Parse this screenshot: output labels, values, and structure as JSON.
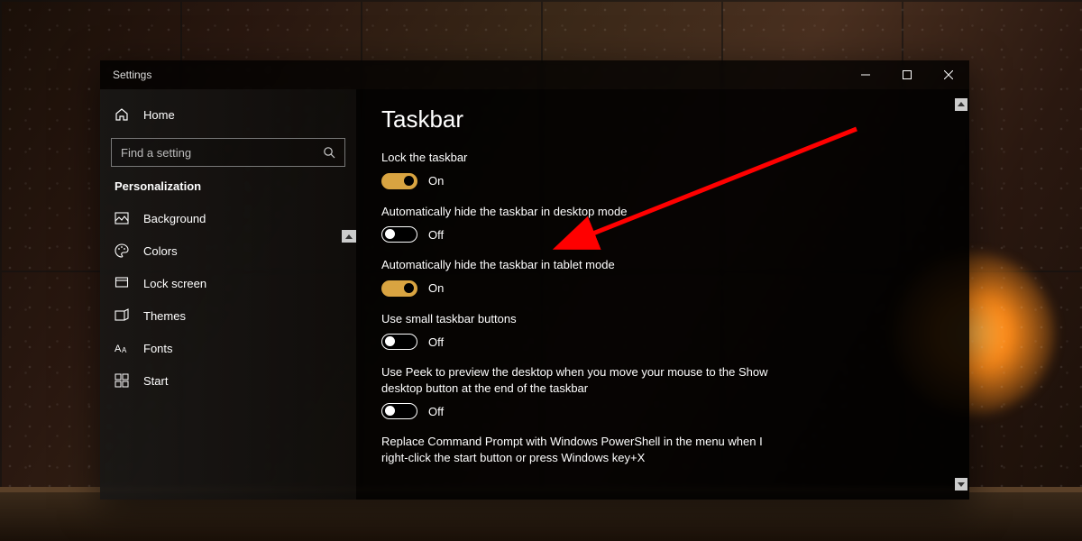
{
  "window": {
    "title": "Settings"
  },
  "sidebar": {
    "home": "Home",
    "search_placeholder": "Find a setting",
    "section": "Personalization",
    "items": [
      {
        "key": "background",
        "label": "Background"
      },
      {
        "key": "colors",
        "label": "Colors"
      },
      {
        "key": "lockscreen",
        "label": "Lock screen"
      },
      {
        "key": "themes",
        "label": "Themes"
      },
      {
        "key": "fonts",
        "label": "Fonts"
      },
      {
        "key": "start",
        "label": "Start"
      }
    ]
  },
  "content": {
    "heading": "Taskbar",
    "settings": [
      {
        "key": "lock",
        "label": "Lock the taskbar",
        "value": true,
        "state_label": "On"
      },
      {
        "key": "autohide_desktop",
        "label": "Automatically hide the taskbar in desktop mode",
        "value": false,
        "state_label": "Off"
      },
      {
        "key": "autohide_tablet",
        "label": "Automatically hide the taskbar in tablet mode",
        "value": true,
        "state_label": "On"
      },
      {
        "key": "small_buttons",
        "label": "Use small taskbar buttons",
        "value": false,
        "state_label": "Off"
      },
      {
        "key": "peek",
        "label": "Use Peek to preview the desktop when you move your mouse to the Show desktop button at the end of the taskbar",
        "value": false,
        "state_label": "Off"
      },
      {
        "key": "powershell",
        "label": "Replace Command Prompt with Windows PowerShell in the menu when I right-click the start button or press Windows key+X",
        "value": null,
        "state_label": ""
      }
    ]
  },
  "colors": {
    "toggle_on": "#d9a441",
    "annotation": "#ff0000"
  },
  "annotation": {
    "target": "autohide_desktop"
  }
}
